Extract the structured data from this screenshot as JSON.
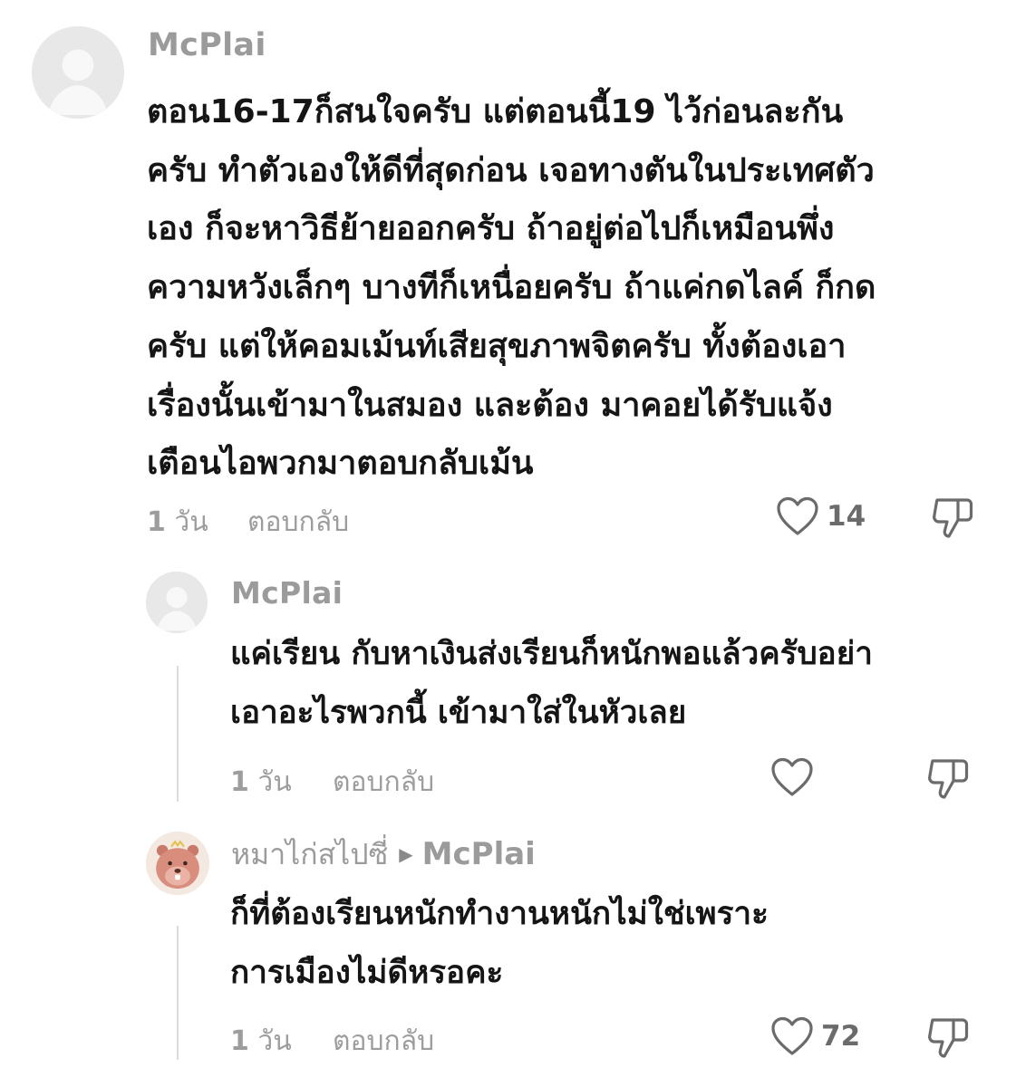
{
  "comments": [
    {
      "username": "McPlai",
      "lines": [
        "ตอน16-17ก็สนใจครับ แต่ตอนนี้19 ไว้ก่อนละกัน",
        "ครับ ทำตัวเองให้ดีที่สุดก่อน เจอทางตันในประเทศตัว",
        "เอง ก็จะหาวิธีย้ายออกครับ ถ้าอยู่ต่อไปก็เหมือนพึ่ง",
        "ความหวังเล็กๆ บางทีก็เหนื่อยครับ ถ้าแค่กดไลค์ ก็กด",
        "ครับ แต่ให้คอมเม้นท์เสียสุขภาพจิตครับ ทั้งต้องเอา",
        "เรื่องนั้นเข้ามาในสมอง และต้อง มาคอยได้รับแจ้ง",
        "เตือนไอพวกมาตอบกลับเม้น"
      ],
      "time_num": "1",
      "time_unit": "วัน",
      "reply_label": "ตอบกลับ",
      "like_count": "14",
      "avatar_icon": "default-avatar-icon"
    },
    {
      "username": "McPlai",
      "lines": [
        "แค่เรียน กับหาเงินส่งเรียนก็หนักพอแล้วครับอย่า",
        "เอาอะไรพวกนี้ เข้ามาใส่ในหัวเลย"
      ],
      "time_num": "1",
      "time_unit": "วัน",
      "reply_label": "ตอบกลับ",
      "like_count": "",
      "avatar_icon": "default-avatar-icon"
    },
    {
      "username": "หมาไก่สไปซี่",
      "reply_to": "McPlai",
      "lines": [
        "ก็ที่ต้องเรียนหนักทำงานหนักไม่ใช่เพราะ",
        "การเมืองไม่ดีหรอคะ"
      ],
      "time_num": "1",
      "time_unit": "วัน",
      "reply_label": "ตอบกลับ",
      "like_count": "72",
      "avatar_icon": "beaver-avatar-icon"
    }
  ],
  "icons": {
    "like": "heart-outline-icon",
    "dislike": "thumbs-down-icon",
    "reply_arrow": "triangle-right-icon"
  },
  "colors": {
    "meta_gray": "#9d9d9d",
    "username_gray": "#9b9b9b",
    "body_text": "#151515"
  }
}
